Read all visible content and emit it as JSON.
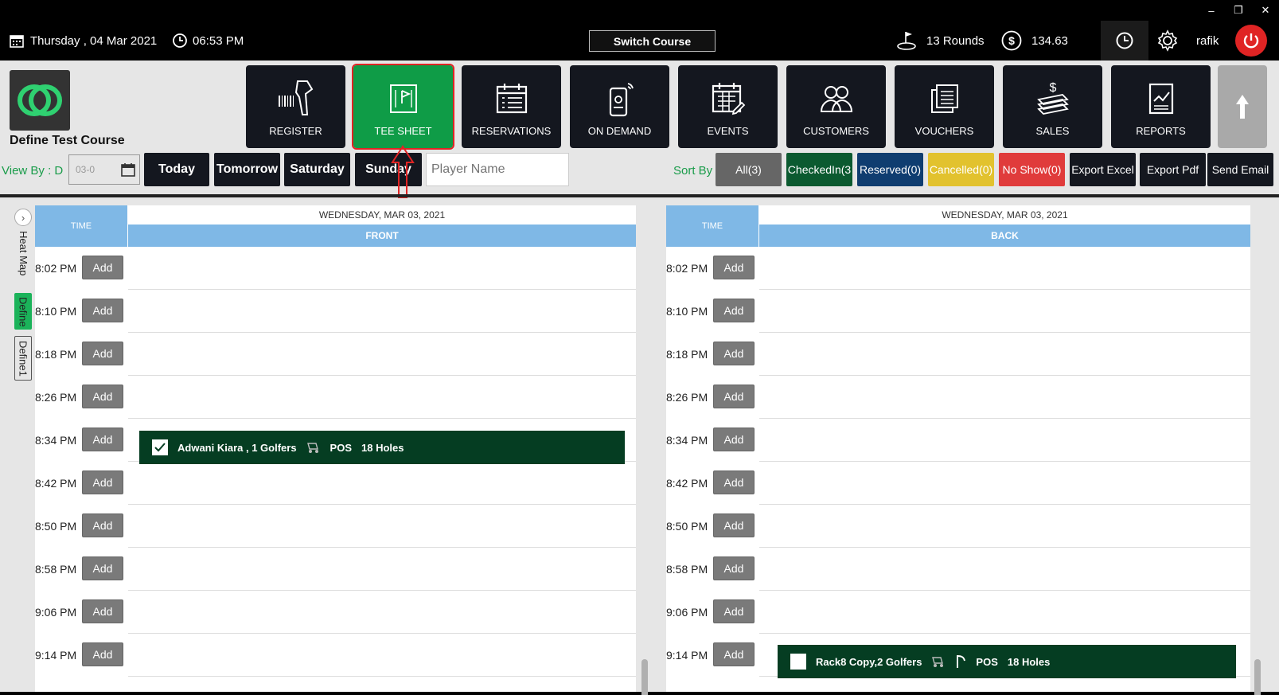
{
  "window": {
    "minimize": "–",
    "restore": "❐",
    "close": "✕"
  },
  "topbar": {
    "date": "Thursday ,  04 Mar 2021",
    "time": "06:53 PM",
    "switch_course": "Switch Course",
    "rounds": "13 Rounds",
    "amount": "134.63",
    "user": "rafik"
  },
  "course": {
    "name": "Define Test Course"
  },
  "nav": [
    {
      "label": "REGISTER",
      "icon": "barcode-scanner-icon"
    },
    {
      "label": "TEE SHEET",
      "icon": "tee-sheet-icon"
    },
    {
      "label": "RESERVATIONS",
      "icon": "reservations-icon"
    },
    {
      "label": "ON DEMAND",
      "icon": "on-demand-icon"
    },
    {
      "label": "EVENTS",
      "icon": "events-icon"
    },
    {
      "label": "CUSTOMERS",
      "icon": "customers-icon"
    },
    {
      "label": "VOUCHERS",
      "icon": "vouchers-icon"
    },
    {
      "label": "SALES",
      "icon": "sales-icon"
    },
    {
      "label": "REPORTS",
      "icon": "reports-icon"
    }
  ],
  "filters": {
    "view_by": "View By : D",
    "date_value": "03-0",
    "today": "Today",
    "tomorrow": "Tomorrow",
    "saturday": "Saturday",
    "sunday": "Sunday",
    "player_placeholder": "Player Name",
    "sort_by": "Sort By",
    "all": "All(3)",
    "checkedin": "CheckedIn(3",
    "reserved": "Reserved(0)",
    "cancelled": "Cancelled(0)",
    "noshow": "No Show(0)",
    "export_excel": "Export Excel",
    "export_pdf": "Export Pdf",
    "send_email": "Send Email"
  },
  "colors": {
    "checkedin": "#0b5a30",
    "reserved": "#0f3d70",
    "cancelled": "#e2c22e",
    "noshow": "#e03b3b",
    "active": "#0f9c47"
  },
  "side": {
    "heat_map": "Heat Map",
    "define": "Define",
    "define1": "Define1"
  },
  "sheets": {
    "time_label": "TIME",
    "add_label": "Add",
    "front": {
      "date": "WEDNESDAY, MAR 03, 2021",
      "name": "FRONT"
    },
    "back": {
      "date": "WEDNESDAY, MAR 03, 2021",
      "name": "BACK"
    },
    "times": [
      "8:02 PM",
      "8:10 PM",
      "8:18 PM",
      "8:26 PM",
      "8:34 PM",
      "8:42 PM",
      "8:50 PM",
      "8:58 PM",
      "9:06 PM",
      "9:14 PM"
    ],
    "front_booking": {
      "text": "Adwani Kiara , 1 Golfers",
      "pos": "POS",
      "holes": "18 Holes",
      "checked": true
    },
    "back_booking": {
      "text": "Rack8 Copy,2 Golfers",
      "pos": "POS",
      "holes": "18 Holes",
      "checked": false
    }
  }
}
